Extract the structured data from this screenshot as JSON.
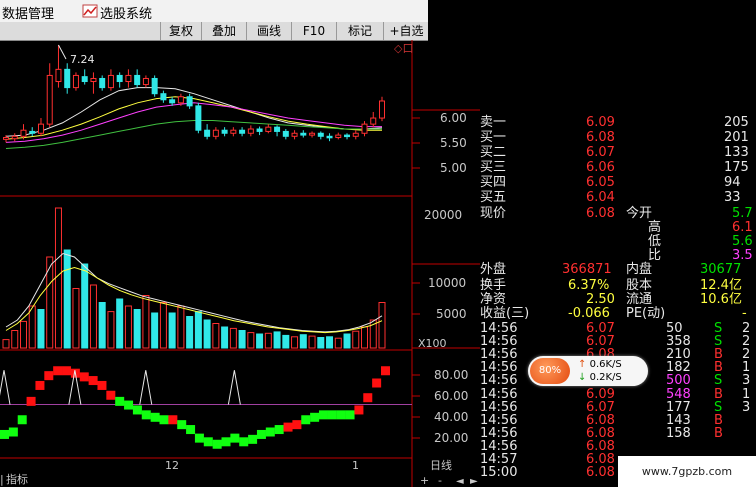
{
  "menubar": {
    "item_data": "数据管理",
    "item_select": "选股系统",
    "select_icon": "stock-select-icon"
  },
  "toolbar": {
    "buttons": [
      "复权",
      "叠加",
      "画线",
      "F10",
      "标记",
      "+自选"
    ],
    "glyph": "◇口"
  },
  "chart": {
    "peak_label": "7.24",
    "price_axis": [
      "6.00",
      "5.50",
      "5.00"
    ],
    "volume_axis": [
      "20000",
      "10000",
      "5000"
    ],
    "volume_unit": "X100",
    "indicator_axis": [
      "80.00",
      "60.00",
      "40.00",
      "20.00"
    ],
    "date_12": "12",
    "date_1": "1",
    "period": "日线",
    "bottom_tab": "指标",
    "bottom_tab_prefix": "|"
  },
  "orderbook": [
    {
      "label": "卖一",
      "price": "6.09",
      "vol": "205"
    },
    {
      "label": "买一",
      "price": "6.08",
      "vol": "201"
    },
    {
      "label": "买二",
      "price": "6.07",
      "vol": "133"
    },
    {
      "label": "买三",
      "price": "6.06",
      "vol": "175"
    },
    {
      "label": "买四",
      "price": "6.05",
      "vol": "94"
    },
    {
      "label": "买五",
      "price": "6.04",
      "vol": "33"
    }
  ],
  "quote": {
    "current_label": "现价",
    "current_value": "6.08",
    "open_label": "今开",
    "open_value": "5.7",
    "high_label": "高",
    "high_value": "6.1",
    "low_label": "低",
    "low_value": "5.6",
    "ratio_label": "比",
    "ratio_value": "3.5",
    "outer_label": "外盘",
    "outer_value": "366871",
    "inner_label": "内盘",
    "inner_value": "30677",
    "turnover_label": "换手",
    "turnover_value": "6.37%",
    "capital_label": "股本",
    "capital_value": "12.4亿",
    "netasset_label": "净资",
    "netasset_value": "2.50",
    "float_label": "流通",
    "float_value": "10.6亿",
    "eps_label": "收益(三)",
    "eps_value": "-0.066",
    "pe_label": "PE(动)",
    "pe_value": "-"
  },
  "ticks": [
    {
      "time": "14:56",
      "price": "6.07",
      "vol": "50",
      "bs": "S",
      "n": "2"
    },
    {
      "time": "14:56",
      "price": "6.07",
      "vol": "358",
      "bs": "S",
      "n": "2"
    },
    {
      "time": "14:56",
      "price": "6.08",
      "vol": "210",
      "bs": "B",
      "n": "2"
    },
    {
      "time": "14:56",
      "price": "6.08",
      "vol": "182",
      "bs": "B",
      "n": "1"
    },
    {
      "time": "14:56",
      "price": "6.08",
      "vol": "500",
      "bs": "S",
      "n": "3"
    },
    {
      "time": "14:56",
      "price": "6.09",
      "vol": "548",
      "bs": "B",
      "n": "1"
    },
    {
      "time": "14:56",
      "price": "6.07",
      "vol": "177",
      "bs": "S",
      "n": "3"
    },
    {
      "time": "14:56",
      "price": "6.08",
      "vol": "143",
      "bs": "B",
      "n": ""
    },
    {
      "time": "14:56",
      "price": "6.08",
      "vol": "158",
      "bs": "B",
      "n": ""
    },
    {
      "time": "14:56",
      "price": "6.08",
      "vol": "",
      "bs": "",
      "n": ""
    },
    {
      "time": "14:57",
      "price": "6.08",
      "vol": "",
      "bs": "",
      "n": ""
    },
    {
      "time": "15:00",
      "price": "6.08",
      "vol": "",
      "bs": "",
      "n": ""
    }
  ],
  "speed_widget": {
    "percent": "80%",
    "up_arrow": "↑",
    "up_rate": "0.6K/S",
    "down_arrow": "↓",
    "down_rate": "0.2K/S"
  },
  "watermark": "www.7gpzb.com",
  "colors": {
    "up": "#ff3030",
    "down": "#30e8e8",
    "axis": "#c00000",
    "ma_white": "#e8e8e8",
    "ma_yellow": "#ffff40",
    "ma_magenta": "#ff40ff",
    "ma_green": "#40c040"
  },
  "chart_data": [
    {
      "type": "candlestick",
      "title": "",
      "price_range": [
        4.7,
        6.6
      ],
      "peak_value": 7.24,
      "candles": [
        [
          5.45,
          5.48,
          5.4,
          5.52
        ],
        [
          5.46,
          5.5,
          5.42,
          5.55
        ],
        [
          5.5,
          5.6,
          5.45,
          5.7
        ],
        [
          5.58,
          5.55,
          5.5,
          5.65
        ],
        [
          5.55,
          5.7,
          5.5,
          5.8
        ],
        [
          5.7,
          6.5,
          5.65,
          6.7
        ],
        [
          6.4,
          6.6,
          6.3,
          7.24
        ],
        [
          6.6,
          6.3,
          6.2,
          6.7
        ],
        [
          6.3,
          6.5,
          6.25,
          6.55
        ],
        [
          6.48,
          6.4,
          6.35,
          6.6
        ],
        [
          6.4,
          6.45,
          6.2,
          6.55
        ],
        [
          6.45,
          6.3,
          6.25,
          6.5
        ],
        [
          6.3,
          6.5,
          6.25,
          6.6
        ],
        [
          6.5,
          6.4,
          6.3,
          6.55
        ],
        [
          6.4,
          6.5,
          6.3,
          6.6
        ],
        [
          6.5,
          6.35,
          6.3,
          6.6
        ],
        [
          6.35,
          6.45,
          6.3,
          6.5
        ],
        [
          6.45,
          6.2,
          6.15,
          6.5
        ],
        [
          6.2,
          6.1,
          6.05,
          6.25
        ],
        [
          6.1,
          6.05,
          6.0,
          6.15
        ],
        [
          6.05,
          6.15,
          6.0,
          6.2
        ],
        [
          6.15,
          6.0,
          5.95,
          6.2
        ],
        [
          6.0,
          5.6,
          5.55,
          6.05
        ],
        [
          5.6,
          5.5,
          5.45,
          5.7
        ],
        [
          5.5,
          5.6,
          5.45,
          5.65
        ],
        [
          5.6,
          5.55,
          5.5,
          5.65
        ],
        [
          5.55,
          5.6,
          5.5,
          5.65
        ],
        [
          5.6,
          5.55,
          5.5,
          5.65
        ],
        [
          5.55,
          5.62,
          5.5,
          5.68
        ],
        [
          5.62,
          5.58,
          5.52,
          5.66
        ],
        [
          5.58,
          5.65,
          5.55,
          5.7
        ],
        [
          5.65,
          5.58,
          5.5,
          5.68
        ],
        [
          5.58,
          5.5,
          5.45,
          5.62
        ],
        [
          5.5,
          5.55,
          5.45,
          5.6
        ],
        [
          5.55,
          5.52,
          5.48,
          5.6
        ],
        [
          5.52,
          5.55,
          5.48,
          5.58
        ],
        [
          5.55,
          5.5,
          5.45,
          5.58
        ],
        [
          5.5,
          5.48,
          5.42,
          5.55
        ],
        [
          5.48,
          5.52,
          5.45,
          5.56
        ],
        [
          5.52,
          5.5,
          5.45,
          5.55
        ],
        [
          5.5,
          5.55,
          5.45,
          5.6
        ],
        [
          5.55,
          5.7,
          5.5,
          5.75
        ],
        [
          5.7,
          5.8,
          5.65,
          5.9
        ],
        [
          5.8,
          6.08,
          5.75,
          6.15
        ]
      ],
      "ma": {
        "white": [
          5.5,
          5.52,
          5.6,
          5.72,
          5.9,
          6.1,
          6.25,
          6.3,
          6.3,
          6.28,
          6.2,
          6.1,
          6.0,
          5.9,
          5.8,
          5.72,
          5.68,
          5.65,
          5.62,
          5.62,
          5.64
        ],
        "yellow": [
          5.45,
          5.48,
          5.52,
          5.6,
          5.7,
          5.82,
          5.95,
          6.05,
          6.12,
          6.15,
          6.12,
          6.05,
          5.98,
          5.9,
          5.82,
          5.75,
          5.7,
          5.66,
          5.62,
          5.6,
          5.6
        ],
        "magenta": [
          5.4,
          5.42,
          5.46,
          5.52,
          5.6,
          5.7,
          5.8,
          5.9,
          5.98,
          6.02,
          6.05,
          6.02,
          5.98,
          5.92,
          5.86,
          5.8,
          5.76,
          5.72,
          5.68,
          5.66,
          5.66
        ],
        "green": [
          5.3,
          5.32,
          5.35,
          5.4,
          5.46,
          5.52,
          5.58,
          5.64,
          5.7,
          5.74,
          5.76,
          5.76,
          5.74,
          5.72,
          5.7,
          5.68,
          5.66,
          5.64,
          5.62,
          5.62,
          5.62
        ]
      }
    },
    {
      "type": "bar",
      "title": "volume",
      "unit": "X100",
      "ylim": [
        0,
        20000
      ],
      "values": [
        1200,
        2500,
        3800,
        6000,
        5500,
        13000,
        20000,
        14000,
        8500,
        12000,
        9000,
        6500,
        5200,
        7000,
        6000,
        5500,
        7500,
        5000,
        6500,
        5000,
        6000,
        4500,
        5200,
        4000,
        3500,
        3000,
        2800,
        2500,
        2200,
        2000,
        2100,
        2300,
        1800,
        1600,
        1900,
        1700,
        1500,
        1600,
        1400,
        2000,
        2400,
        3000,
        4000,
        6500
      ],
      "up": [
        1,
        1,
        1,
        1,
        0,
        1,
        1,
        0,
        1,
        0,
        1,
        0,
        1,
        0,
        1,
        0,
        1,
        0,
        1,
        0,
        1,
        0,
        0,
        0,
        1,
        0,
        1,
        0,
        1,
        0,
        1,
        0,
        0,
        1,
        0,
        1,
        0,
        0,
        1,
        0,
        1,
        1,
        1,
        1
      ],
      "ma": {
        "white": [
          3000,
          4000,
          6000,
          9000,
          12000,
          13500,
          13000,
          11500,
          10000,
          9200,
          8600,
          8000,
          7400,
          7000,
          6600,
          6200,
          5800,
          5400,
          5000,
          4600,
          4200,
          3800,
          3500,
          3200,
          2900,
          2700,
          2500,
          2400,
          2300,
          2400,
          2600,
          3000,
          3600,
          4600
        ],
        "yellow": [
          2500,
          3500,
          5000,
          7500,
          9500,
          11000,
          11500,
          11000,
          10000,
          9000,
          8200,
          7600,
          7100,
          6700,
          6300,
          5900,
          5500,
          5100,
          4700,
          4300,
          3900,
          3600,
          3300,
          3000,
          2800,
          2600,
          2400,
          2300,
          2200,
          2300,
          2500,
          2800,
          3200,
          3900
        ]
      }
    },
    {
      "type": "indicator",
      "axis": [
        20,
        40,
        60,
        80
      ],
      "ylim": [
        10,
        90
      ],
      "blocks": [
        [
          28,
          "g"
        ],
        [
          30,
          "g"
        ],
        [
          40,
          "g"
        ],
        [
          55,
          "r"
        ],
        [
          68,
          "r"
        ],
        [
          76,
          "r"
        ],
        [
          80,
          "r"
        ],
        [
          80,
          "r"
        ],
        [
          78,
          "r"
        ],
        [
          75,
          "r"
        ],
        [
          72,
          "r"
        ],
        [
          68,
          "r"
        ],
        [
          60,
          "r"
        ],
        [
          55,
          "g"
        ],
        [
          52,
          "g"
        ],
        [
          48,
          "g"
        ],
        [
          44,
          "g"
        ],
        [
          42,
          "g"
        ],
        [
          40,
          "g"
        ],
        [
          40,
          "r"
        ],
        [
          36,
          "g"
        ],
        [
          32,
          "g"
        ],
        [
          25,
          "g"
        ],
        [
          22,
          "g"
        ],
        [
          20,
          "g"
        ],
        [
          22,
          "g"
        ],
        [
          25,
          "g"
        ],
        [
          22,
          "g"
        ],
        [
          24,
          "g"
        ],
        [
          28,
          "g"
        ],
        [
          30,
          "g"
        ],
        [
          32,
          "g"
        ],
        [
          34,
          "r"
        ],
        [
          36,
          "r"
        ],
        [
          40,
          "g"
        ],
        [
          42,
          "g"
        ],
        [
          44,
          "g"
        ],
        [
          44,
          "g"
        ],
        [
          44,
          "g"
        ],
        [
          44,
          "g"
        ],
        [
          48,
          "r"
        ],
        [
          58,
          "r"
        ],
        [
          70,
          "r"
        ],
        [
          80,
          "r"
        ]
      ],
      "triangles": [
        0,
        8,
        16,
        26
      ]
    }
  ]
}
